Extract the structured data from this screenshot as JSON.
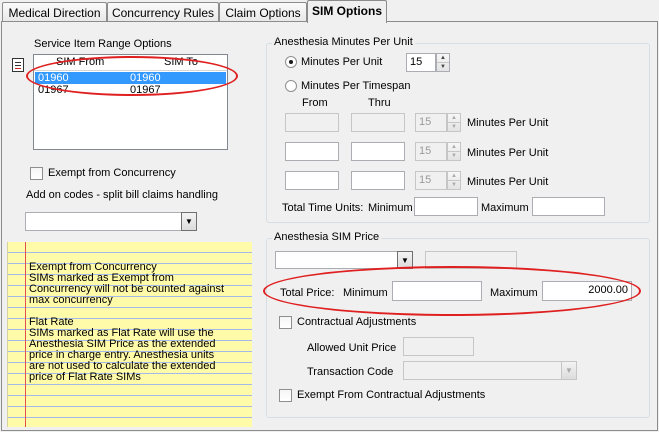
{
  "tabs": [
    {
      "label": "Medical Direction",
      "active": false
    },
    {
      "label": "Concurrency Rules",
      "active": false
    },
    {
      "label": "Claim Options",
      "active": false
    },
    {
      "label": "SIM Options",
      "active": true
    }
  ],
  "service_item": {
    "group_title": "Service Item Range Options",
    "columns": [
      "SIM From",
      "SIM To"
    ],
    "rows": [
      {
        "from": "01960",
        "to": "01960",
        "selected": true
      },
      {
        "from": "01967",
        "to": "01967",
        "selected": false
      }
    ]
  },
  "exempt_concurrency_label": "Exempt from Concurrency",
  "addon_label": "Add on codes - split bill claims handling",
  "addon_value": "",
  "notes_lines": [
    "Exempt from Concurrency",
    "SIMs marked as Exempt from",
    "Concurrency will not be counted against",
    "max concurrency",
    "",
    "Flat Rate",
    "SIMs marked as Flat Rate will use the",
    "Anesthesia SIM Price as the extended",
    "price in charge entry. Anesthesia units",
    "are not used to calculate the extended",
    "price of Flat Rate SIMs"
  ],
  "minutes_per_unit": {
    "group_title": "Anesthesia Minutes Per Unit",
    "radio_mpu": "Minutes Per Unit",
    "mpu_value": "15",
    "radio_timespan": "Minutes Per Timespan",
    "from_label": "From",
    "thru_label": "Thru",
    "rows": [
      {
        "from": "",
        "thru": "",
        "value": "15",
        "suffix": "Minutes Per Unit"
      },
      {
        "from": "",
        "thru": "",
        "value": "15",
        "suffix": "Minutes Per Unit"
      },
      {
        "from": "",
        "thru": "",
        "value": "15",
        "suffix": "Minutes Per Unit"
      }
    ],
    "total_label": "Total Time Units:",
    "min_label": "Minimum",
    "min_value": "",
    "max_label": "Maximum",
    "max_value": ""
  },
  "sim_price": {
    "group_title": "Anesthesia SIM Price",
    "select_value": "",
    "price_value": "",
    "total_label": "Total Price:",
    "min_label": "Minimum",
    "min_value": "",
    "max_label": "Maximum",
    "max_value": "2000.00",
    "contractual_label": "Contractual Adjustments",
    "allowed_label": "Allowed Unit Price",
    "allowed_value": "",
    "transaction_label": "Transaction Code",
    "transaction_value": "",
    "exempt_contractual_label": "Exempt From Contractual Adjustments"
  },
  "colors": {
    "highlight": "#e02020",
    "selection": "#3399ff",
    "notes_bg": "#fffba8"
  }
}
